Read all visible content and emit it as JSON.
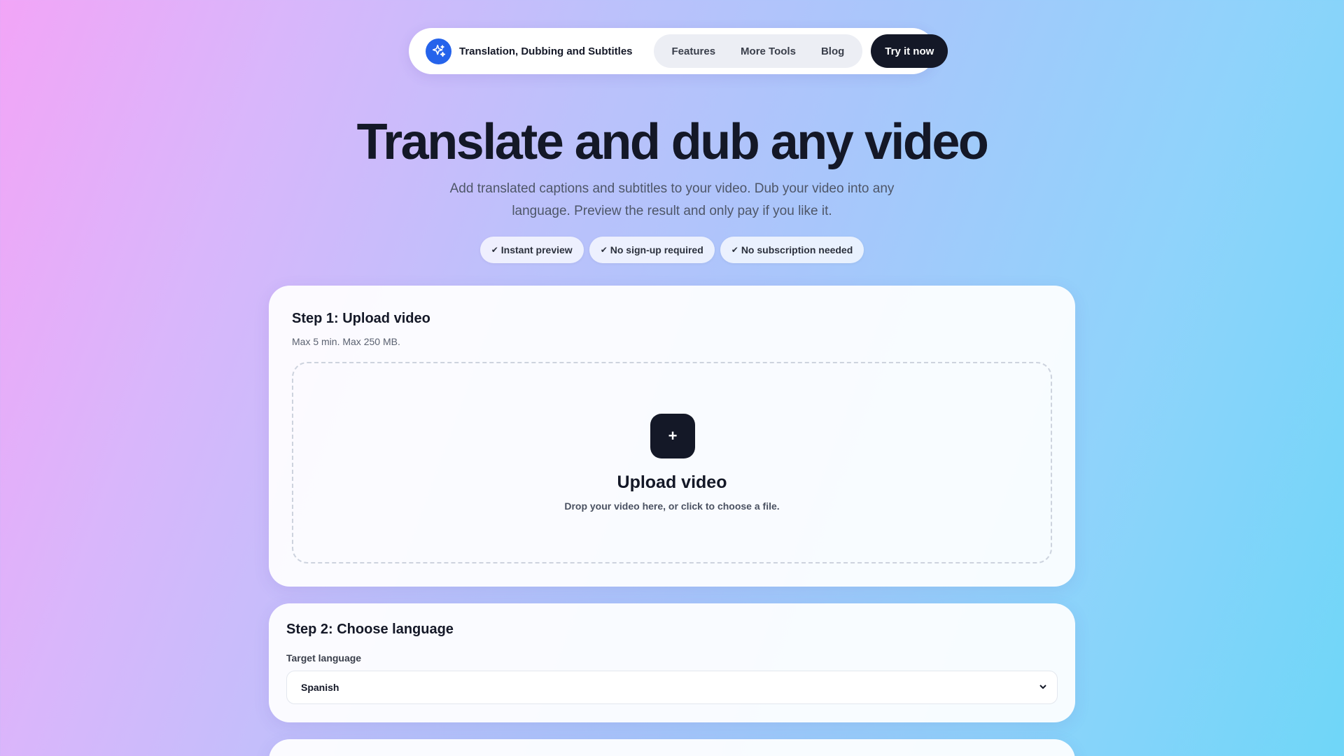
{
  "nav": {
    "brand_icon": "sparkles-icon",
    "brand_name": "Translation, Dubbing and Subtitles",
    "links": [
      {
        "label": "Features"
      },
      {
        "label": "More Tools"
      },
      {
        "label": "Blog"
      }
    ],
    "cta_label": "Try it now"
  },
  "hero": {
    "title": "Translate and dub any video",
    "subtitle": "Add translated captions and subtitles to your video. Dub your video into any language. Preview the result and only pay if you like it.",
    "pills": [
      {
        "icon": "check-icon",
        "label": "Instant preview"
      },
      {
        "icon": "check-icon",
        "label": "No sign-up required"
      },
      {
        "icon": "check-icon",
        "label": "No subscription needed"
      }
    ]
  },
  "step1": {
    "title": "Step 1: Upload video",
    "note": "Max 5 min. Max 250 MB.",
    "upload_icon": "plus-icon",
    "upload_glyph": "+",
    "upload_title": "Upload video",
    "upload_hint": "Drop your video here, or click to choose a file."
  },
  "step2": {
    "title": "Step 2: Choose language",
    "field_label": "Target language",
    "selected_language": "Spanish",
    "selected_flag_icon": "flag-icon"
  },
  "colors": {
    "brand_blue": "#2563eb",
    "dark": "#141827"
  }
}
